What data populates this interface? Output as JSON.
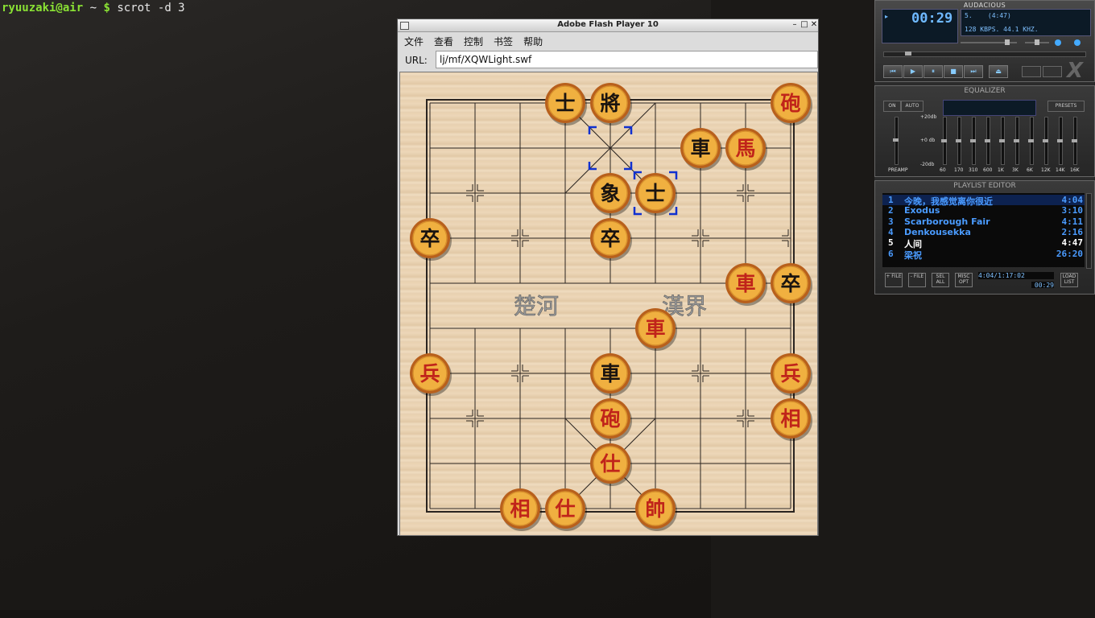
{
  "terminal": {
    "user": "ryuuzaki@air",
    "path": " ~ ",
    "dollar": "$",
    "command": " scrot -d 3"
  },
  "flash": {
    "title": "Adobe Flash Player 10",
    "menu": [
      "文件",
      "查看",
      "控制",
      "书签",
      "帮助"
    ],
    "url_label": "URL:",
    "url_value": "lj/mf/XQWLight.swf",
    "river_left": "楚河",
    "river_right": "漢界",
    "pieces": [
      {
        "char": "士",
        "side": "black",
        "col": 3,
        "row": 0
      },
      {
        "char": "將",
        "side": "black",
        "col": 4,
        "row": 0
      },
      {
        "char": "砲",
        "side": "red",
        "col": 8,
        "row": 0
      },
      {
        "char": "車",
        "side": "black",
        "col": 6,
        "row": 1
      },
      {
        "char": "馬",
        "side": "red",
        "col": 7,
        "row": 1
      },
      {
        "char": "象",
        "side": "black",
        "col": 4,
        "row": 2
      },
      {
        "char": "士",
        "side": "black",
        "col": 5,
        "row": 2
      },
      {
        "char": "卒",
        "side": "black",
        "col": 0,
        "row": 3
      },
      {
        "char": "卒",
        "side": "black",
        "col": 4,
        "row": 3
      },
      {
        "char": "車",
        "side": "red",
        "col": 7,
        "row": 4
      },
      {
        "char": "卒",
        "side": "black",
        "col": 8,
        "row": 4
      },
      {
        "char": "車",
        "side": "red",
        "col": 5,
        "row": 5
      },
      {
        "char": "兵",
        "side": "red",
        "col": 0,
        "row": 6
      },
      {
        "char": "車",
        "side": "black",
        "col": 4,
        "row": 6
      },
      {
        "char": "兵",
        "side": "red",
        "col": 8,
        "row": 6
      },
      {
        "char": "砲",
        "side": "red",
        "col": 4,
        "row": 7
      },
      {
        "char": "相",
        "side": "red",
        "col": 8,
        "row": 7
      },
      {
        "char": "仕",
        "side": "red",
        "col": 4,
        "row": 8
      },
      {
        "char": "相",
        "side": "red",
        "col": 2,
        "row": 9
      },
      {
        "char": "仕",
        "side": "red",
        "col": 3,
        "row": 9
      },
      {
        "char": "帥",
        "side": "red",
        "col": 5,
        "row": 9
      }
    ],
    "selection": [
      {
        "col": 4,
        "row": 1
      },
      {
        "col": 5,
        "row": 2
      }
    ],
    "colors": {
      "red_char": "#c0241a",
      "black_char": "#1a1410",
      "piece_face": "#f0b040",
      "piece_rim": "#b8601c"
    }
  },
  "audacious": {
    "title": "AUDACIOUS",
    "time": "00:29",
    "song": "5.    (4:47)",
    "bitrate": "128 KBPS. 44.1 KHZ.",
    "eq_title": "EQUALIZER",
    "eq_on": "ON",
    "eq_auto": "AUTO",
    "eq_presets": "PRESETS",
    "eq_db_top": "+20db",
    "eq_db_mid": "+0 db",
    "eq_db_bot": "-20db",
    "eq_preamp": "PREAMP",
    "eq_bands": [
      "60",
      "170",
      "310",
      "600",
      "1K",
      "3K",
      "6K",
      "12K",
      "14K",
      "16K"
    ],
    "pl_title": "PLAYLIST EDITOR",
    "playlist": [
      {
        "num": "1",
        "name": "今晚，我感觉离你很近",
        "len": "4:04"
      },
      {
        "num": "2",
        "name": "Exodus",
        "len": "3:10"
      },
      {
        "num": "3",
        "name": "Scarborough Fair",
        "len": "4:11"
      },
      {
        "num": "4",
        "name": "Denkousekka",
        "len": "2:16"
      },
      {
        "num": "5",
        "name": "人间",
        "len": "4:47"
      },
      {
        "num": "6",
        "name": "梁祝",
        "len": "26:20"
      }
    ],
    "pl_info": "4:04/1:17:02",
    "pl_time": "00:29",
    "pl_buttons": [
      "+ FILE",
      "- FILE",
      "SEL ALL",
      "MISC OPT",
      "LOAD LIST"
    ]
  }
}
